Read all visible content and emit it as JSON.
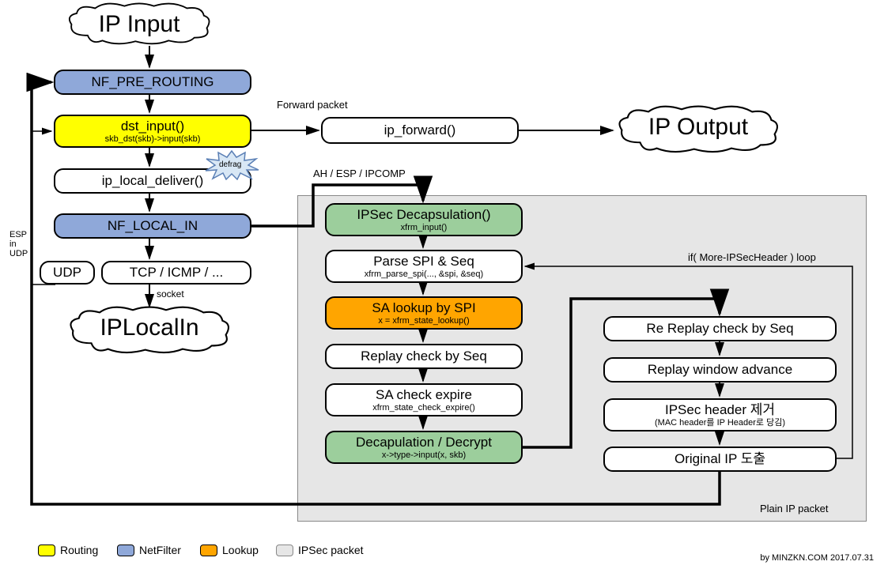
{
  "clouds": {
    "input": "IP Input",
    "output": "IP Output",
    "local": "IPLocalIn"
  },
  "nodes": {
    "pre_routing": {
      "title": "NF_PRE_ROUTING"
    },
    "dst_input": {
      "title": "dst_input()",
      "sub": "skb_dst(skb)->input(skb)"
    },
    "forward": {
      "title": "ip_forward()"
    },
    "local_deliver": {
      "title": "ip_local_deliver()"
    },
    "local_in": {
      "title": "NF_LOCAL_IN"
    },
    "udp": {
      "title": "UDP"
    },
    "tcp": {
      "title": "TCP / ICMP / ..."
    },
    "decap": {
      "title": "IPSec Decapsulation()",
      "sub": "xfrm_input()"
    },
    "parse": {
      "title": "Parse SPI & Seq",
      "sub": "xfrm_parse_spi(..., &spi, &seq)"
    },
    "lookup": {
      "title": "SA lookup by SPI",
      "sub": "x = xfrm_state_lookup()"
    },
    "replay": {
      "title": "Replay check by Seq"
    },
    "expire": {
      "title": "SA check expire",
      "sub": "xfrm_state_check_expire()"
    },
    "decrypt": {
      "title": "Decapulation / Decrypt",
      "sub": "x->type->input(x, skb)"
    },
    "rereplay": {
      "title": "Re Replay check by Seq"
    },
    "advance": {
      "title": "Replay window advance"
    },
    "remove": {
      "title": "IPSec header 제거",
      "sub": "(MAC header를 IP Header로 당김)"
    },
    "original": {
      "title": "Original IP 도출"
    }
  },
  "labels": {
    "forward_packet": "Forward packet",
    "ah_esp": "AH / ESP / IPCOMP",
    "esp_udp": "ESP\nin\nUDP",
    "socket": "socket",
    "defrag": "defrag",
    "loop": "if( More-IPSecHeader ) loop",
    "plain": "Plain IP packet"
  },
  "legend": {
    "routing": "Routing",
    "netfilter": "NetFilter",
    "lookup": "Lookup",
    "ipsec": "IPSec packet"
  },
  "colors": {
    "routing": "#ffff00",
    "netfilter": "#8fa8d9",
    "lookup": "#ffa500",
    "ipsec_bg": "#e6e6e6",
    "green": "#9cce9c"
  },
  "credit": "by MINZKN.COM 2017.07.31"
}
